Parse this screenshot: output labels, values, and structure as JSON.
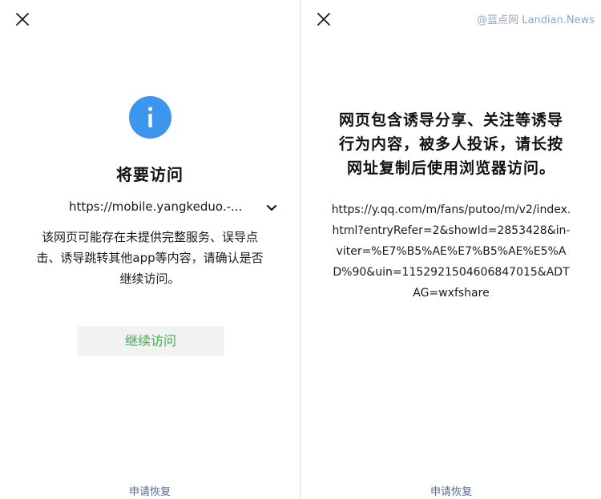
{
  "left_dialog": {
    "title": "将要访问",
    "url": "https://mobile.yangkeduo.-...",
    "description_lines": [
      "该网页可能存在未提供完整服务、误导点",
      "击、诱导跳转其他app等内容，请确认是否",
      "继续访问。"
    ],
    "continue_label": "继续访问",
    "restore_label": "申请恢复"
  },
  "right_dialog": {
    "message_lines": [
      "网页包含诱导分享、关注等诱导",
      "行为内容，被多人投诉，请长按",
      "网址复制后使用浏览器访问。"
    ],
    "url_lines": [
      "https://y.qq.com/m/fans/putoo/m/v2/index.",
      "html?entryRefer=2&showId=2853428&in-",
      "viter=%E7%B5%AE%E7%B5%AE%E5%A",
      "D%90&uin=1152921504606847015&ADT",
      "AG=wxfshare"
    ],
    "restore_label": "申请恢复"
  },
  "watermark": "@蓝点网 Landian.News",
  "colors": {
    "info_blue": "#3d96ee",
    "continue_green": "#3bb24a",
    "link_blue": "#576b95"
  },
  "icons": {
    "close": "close-icon",
    "info": "info-icon",
    "chevron": "chevron-down-icon"
  }
}
